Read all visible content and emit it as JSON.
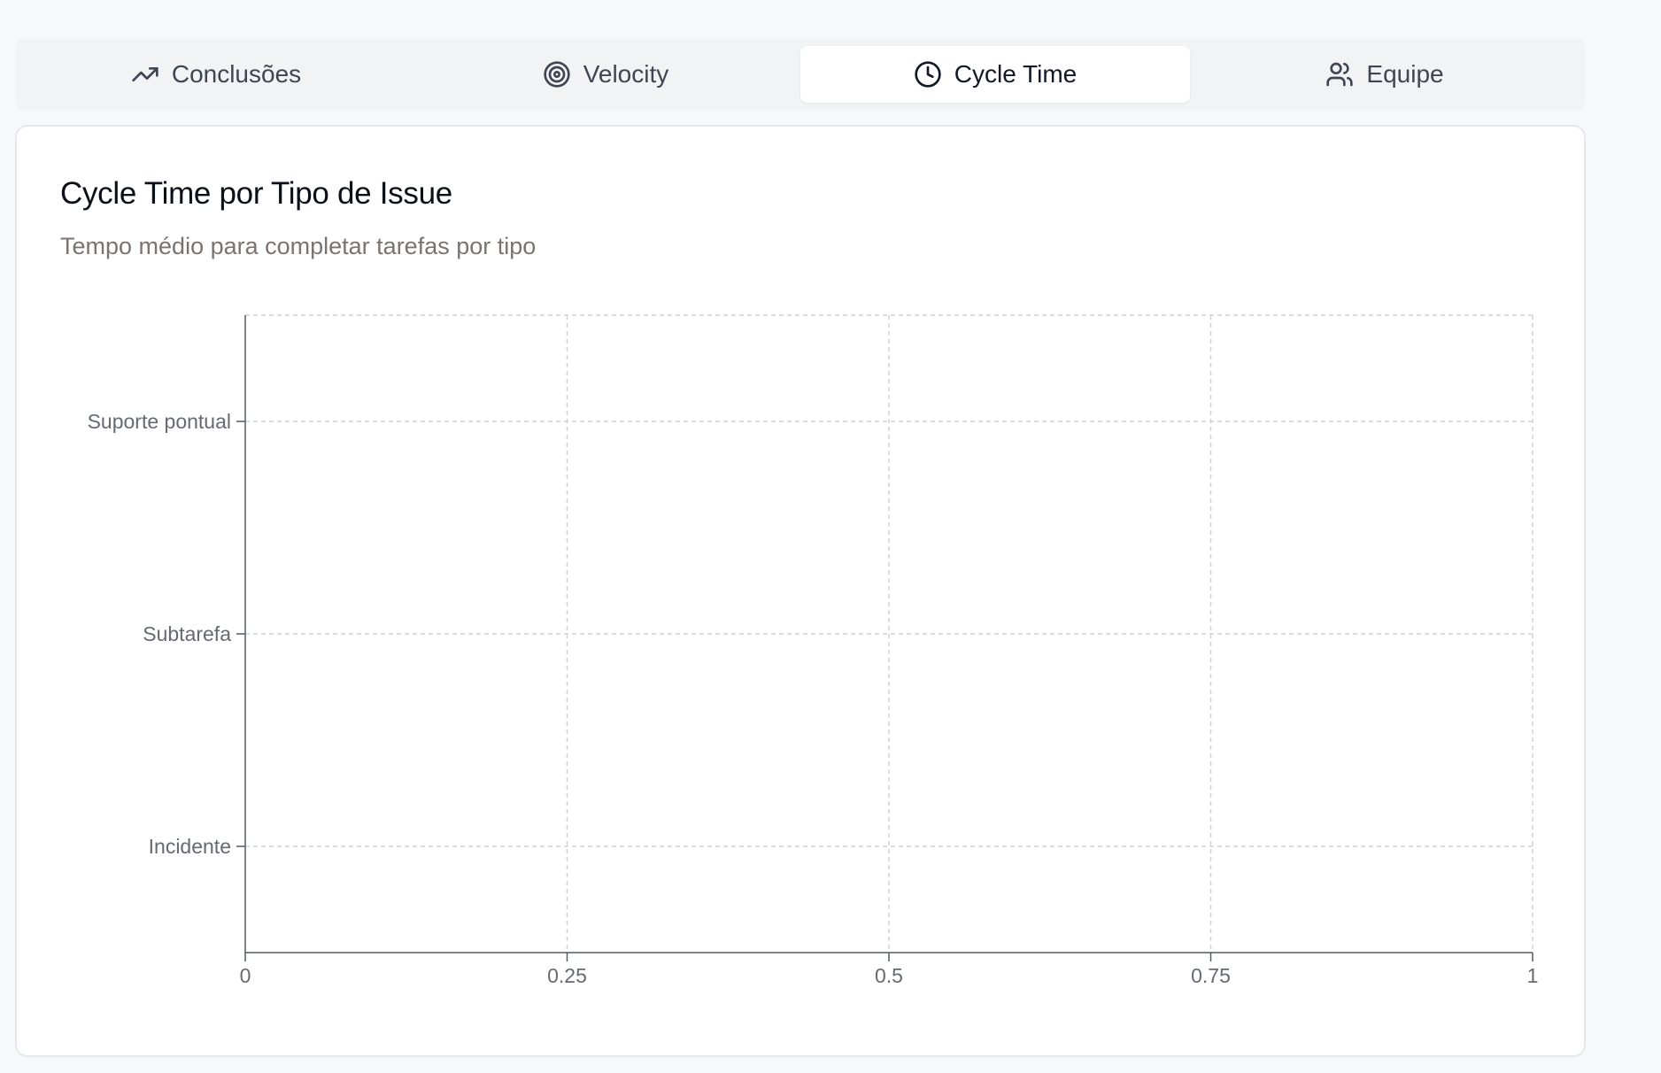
{
  "tabs": [
    {
      "label": "Conclusões",
      "icon": "trending-up-icon",
      "active": false
    },
    {
      "label": "Velocity",
      "icon": "target-icon",
      "active": false
    },
    {
      "label": "Cycle Time",
      "icon": "clock-icon",
      "active": true
    },
    {
      "label": "Equipe",
      "icon": "users-icon",
      "active": false
    }
  ],
  "card": {
    "title": "Cycle Time por Tipo de Issue",
    "subtitle": "Tempo médio para completar tarefas por tipo"
  },
  "chart_data": {
    "type": "bar",
    "orientation": "horizontal",
    "categories": [
      "Suporte pontual",
      "Subtarefa",
      "Incidente"
    ],
    "values": [
      0,
      0,
      0
    ],
    "xlim": [
      0,
      1
    ],
    "xticks": [
      "0",
      "0.25",
      "0.5",
      "0.75",
      "1"
    ],
    "grid": true,
    "title": "",
    "xlabel": "",
    "ylabel": ""
  }
}
